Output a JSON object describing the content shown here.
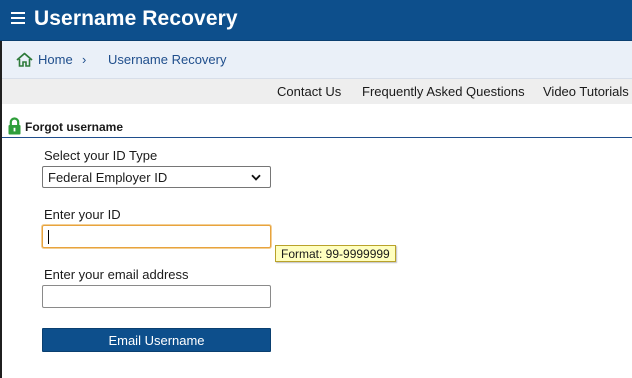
{
  "header": {
    "title": "Username Recovery",
    "menu_icon": "hamburger-menu-icon"
  },
  "breadcrumb": {
    "home_icon": "home-icon",
    "home": "Home",
    "separator": "›",
    "current": "Username Recovery"
  },
  "nav_links": {
    "contact": "Contact Us",
    "faq": "Frequently Asked Questions",
    "videos": "Video Tutorials"
  },
  "section": {
    "icon": "lock-icon",
    "title": "Forgot username"
  },
  "form": {
    "id_type_label": "Select your ID Type",
    "id_type_value": "Federal Employer ID",
    "id_label": "Enter your ID",
    "id_value": "",
    "id_tooltip": "Format: 99-9999999",
    "email_label": "Enter your email address",
    "email_value": "",
    "submit_label": "Email Username"
  },
  "colors": {
    "brand": "#0d4f8c",
    "lock": "#2e9e3a",
    "breadcrumb_bg": "#eaf0f8",
    "tooltip_bg": "#ffffbf",
    "focus": "#e8a33d"
  }
}
